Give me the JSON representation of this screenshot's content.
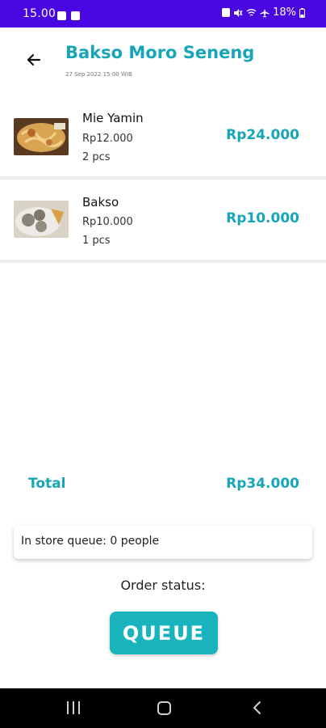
{
  "status_bar": {
    "time": "15.00",
    "battery": "18%"
  },
  "header": {
    "title": "Bakso Moro Seneng",
    "date": "27 Sep 2022 15:00 WIB"
  },
  "items": [
    {
      "name": "Mie Yamin",
      "price": "Rp12.000",
      "qty": "2 pcs",
      "total": "Rp24.000"
    },
    {
      "name": "Bakso",
      "price": "Rp10.000",
      "qty": "1 pcs",
      "total": "Rp10.000"
    }
  ],
  "total": {
    "label": "Total",
    "value": "Rp34.000"
  },
  "queue": {
    "text": "In store queue: 0 people"
  },
  "order_status": {
    "label": "Order status:",
    "status": "QUEUE"
  },
  "colors": {
    "accent": "#17a6b8",
    "status_bar": "#4a06e0",
    "button": "#19b3be"
  },
  "icons": [
    "back-arrow-icon",
    "gallery-icon",
    "message-icon",
    "lock-icon",
    "mute-icon",
    "wifi-icon",
    "airplane-icon",
    "battery-icon",
    "recent-apps-icon",
    "home-icon",
    "nav-back-icon"
  ]
}
